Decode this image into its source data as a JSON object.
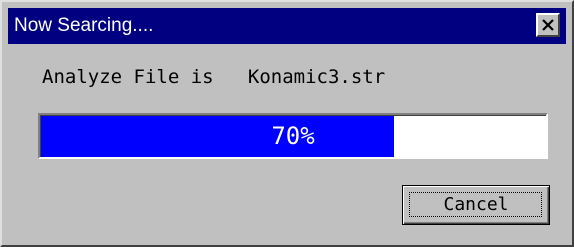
{
  "window": {
    "title": "Now Searcing...."
  },
  "message": {
    "label": "Analyze File is",
    "filename": "Konamic3.str"
  },
  "progress": {
    "value": 0.7,
    "text": "70%"
  },
  "buttons": {
    "cancel": "Cancel"
  },
  "icons": {
    "close": "close-icon"
  },
  "colors": {
    "titlebar": "#000080",
    "progress_fill": "#0000ff",
    "window_bg": "#c0c0c0"
  }
}
